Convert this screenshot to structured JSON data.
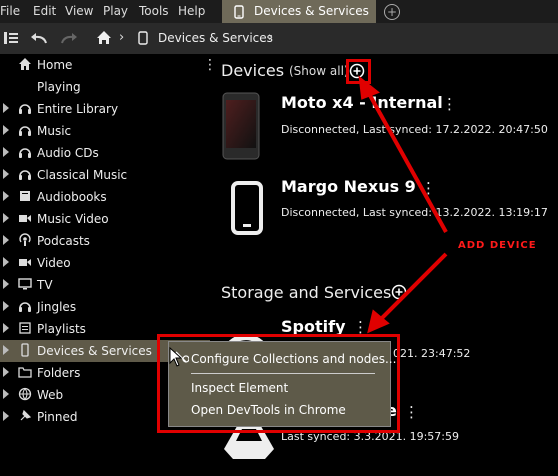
{
  "menubar": {
    "items": [
      "File",
      "Edit",
      "View",
      "Play",
      "Tools",
      "Help"
    ],
    "active_tab": "Devices & Services"
  },
  "toolbar": {
    "breadcrumb": "Devices & Services"
  },
  "sidebar": {
    "items": [
      {
        "label": "Home",
        "icon": "home-icon",
        "expandable": false
      },
      {
        "label": "Playing",
        "icon": "none",
        "expandable": false
      },
      {
        "label": "Entire Library",
        "icon": "headphones-icon",
        "expandable": true
      },
      {
        "label": "Music",
        "icon": "headphones-icon",
        "expandable": true
      },
      {
        "label": "Audio CDs",
        "icon": "headphones-icon",
        "expandable": true
      },
      {
        "label": "Classical Music",
        "icon": "headphones-icon",
        "expandable": true
      },
      {
        "label": "Audiobooks",
        "icon": "book-icon",
        "expandable": true
      },
      {
        "label": "Music Video",
        "icon": "video-icon",
        "expandable": true
      },
      {
        "label": "Podcasts",
        "icon": "podcast-icon",
        "expandable": true
      },
      {
        "label": "Video",
        "icon": "video-icon",
        "expandable": true
      },
      {
        "label": "TV",
        "icon": "tv-icon",
        "expandable": true
      },
      {
        "label": "Jingles",
        "icon": "headphones-icon",
        "expandable": true
      },
      {
        "label": "Playlists",
        "icon": "list-icon",
        "expandable": true
      },
      {
        "label": "Devices & Services",
        "icon": "phone-icon",
        "expandable": true,
        "selected": true
      },
      {
        "label": "Folders",
        "icon": "folder-icon",
        "expandable": true
      },
      {
        "label": "Web",
        "icon": "globe-icon",
        "expandable": true
      },
      {
        "label": "Pinned",
        "icon": "pin-icon",
        "expandable": true
      }
    ]
  },
  "main": {
    "devices_heading": "Devices",
    "show_all": "(Show all)",
    "devices": [
      {
        "name": "Moto x4 - Internal",
        "status": "Disconnected, Last synced: 17.2.2022. 20:47:50"
      },
      {
        "name": "Margo Nexus 9",
        "status": "Disconnected, Last synced: 13.2.2022. 13:19:17"
      }
    ],
    "storage_heading": "Storage and Services",
    "services": [
      {
        "name": "Spotify",
        "status": "021. 23:47:52"
      },
      {
        "name": "e",
        "status": "Last synced: 3.3.2021. 19:57:59"
      }
    ]
  },
  "context_menu": {
    "items": [
      "Configure Collections and nodes...",
      "Inspect Element",
      "Open DevTools in Chrome"
    ]
  },
  "annotation": {
    "label": "ADD DEVICE",
    "color": "#e00000"
  }
}
